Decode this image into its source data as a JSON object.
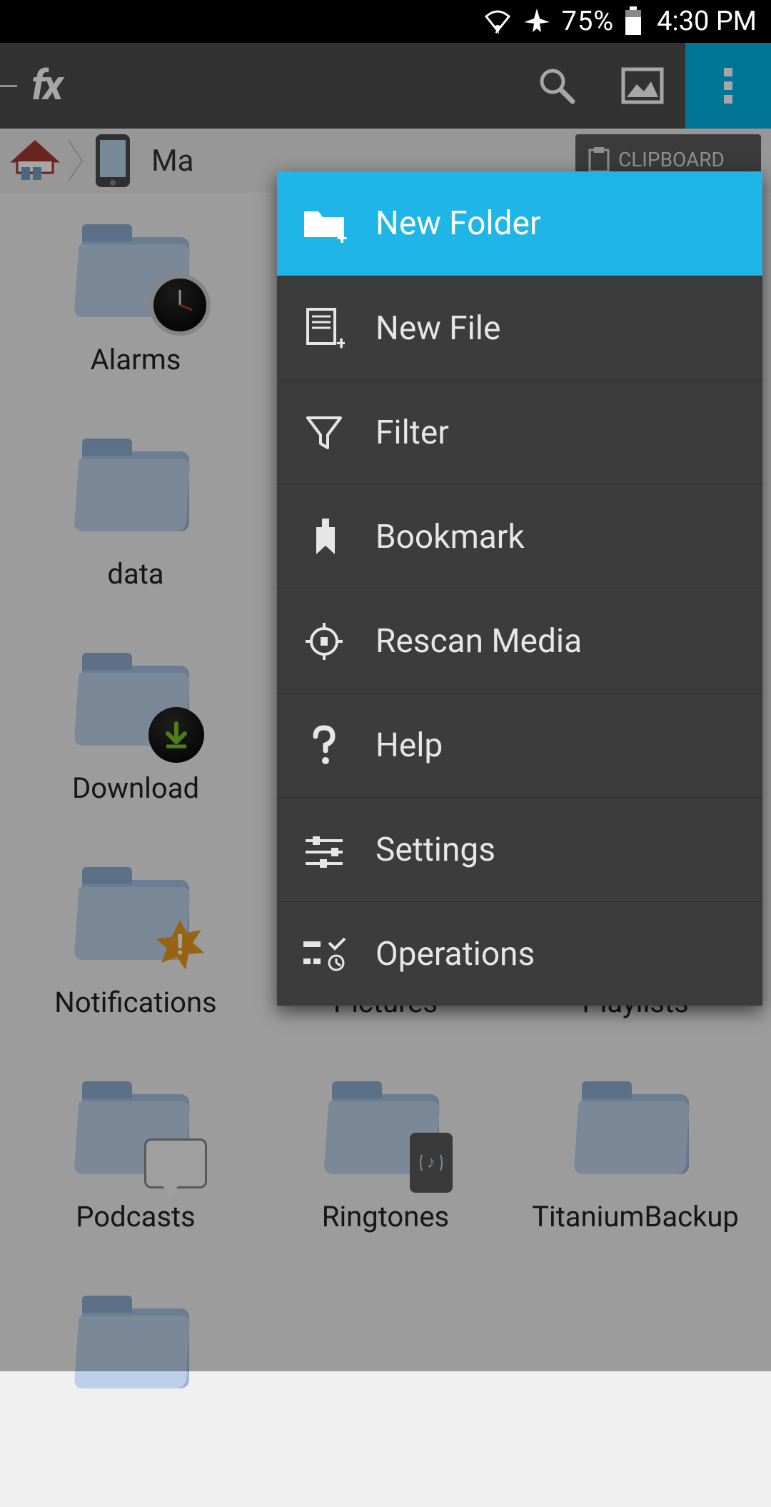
{
  "status": {
    "battery_percent": "75%",
    "time": "4:30 PM"
  },
  "app": {
    "logo_text": "fx",
    "clipboard_label": "CLIPBOARD"
  },
  "breadcrumb": {
    "current_label": "Ma"
  },
  "folders": [
    {
      "name": "Alarms",
      "overlay": "clock"
    },
    {
      "name": "",
      "overlay": ""
    },
    {
      "name": "",
      "overlay": ""
    },
    {
      "name": "data",
      "overlay": ""
    },
    {
      "name": "",
      "overlay": ""
    },
    {
      "name": "",
      "overlay": ""
    },
    {
      "name": "Download",
      "overlay": "download"
    },
    {
      "name": "",
      "overlay": ""
    },
    {
      "name": "",
      "overlay": ""
    },
    {
      "name": "Notifications",
      "overlay": "star"
    },
    {
      "name": "Pictures",
      "overlay": ""
    },
    {
      "name": "Playlists",
      "overlay": ""
    },
    {
      "name": "Podcasts",
      "overlay": "speech"
    },
    {
      "name": "Ringtones",
      "overlay": "phone"
    },
    {
      "name": "TitaniumBackup",
      "overlay": ""
    },
    {
      "name": "",
      "overlay": ""
    }
  ],
  "menu": {
    "items": [
      {
        "label": "New Folder",
        "icon": "folder-add"
      },
      {
        "label": "New File",
        "icon": "file-add"
      },
      {
        "label": "Filter",
        "icon": "funnel"
      },
      {
        "label": "Bookmark",
        "icon": "bookmark"
      },
      {
        "label": "Rescan Media",
        "icon": "crosshair"
      },
      {
        "label": "Help",
        "icon": "question"
      },
      {
        "label": "Settings",
        "icon": "sliders"
      },
      {
        "label": "Operations",
        "icon": "operations"
      }
    ]
  },
  "colors": {
    "accent": "#1fb5e6"
  }
}
